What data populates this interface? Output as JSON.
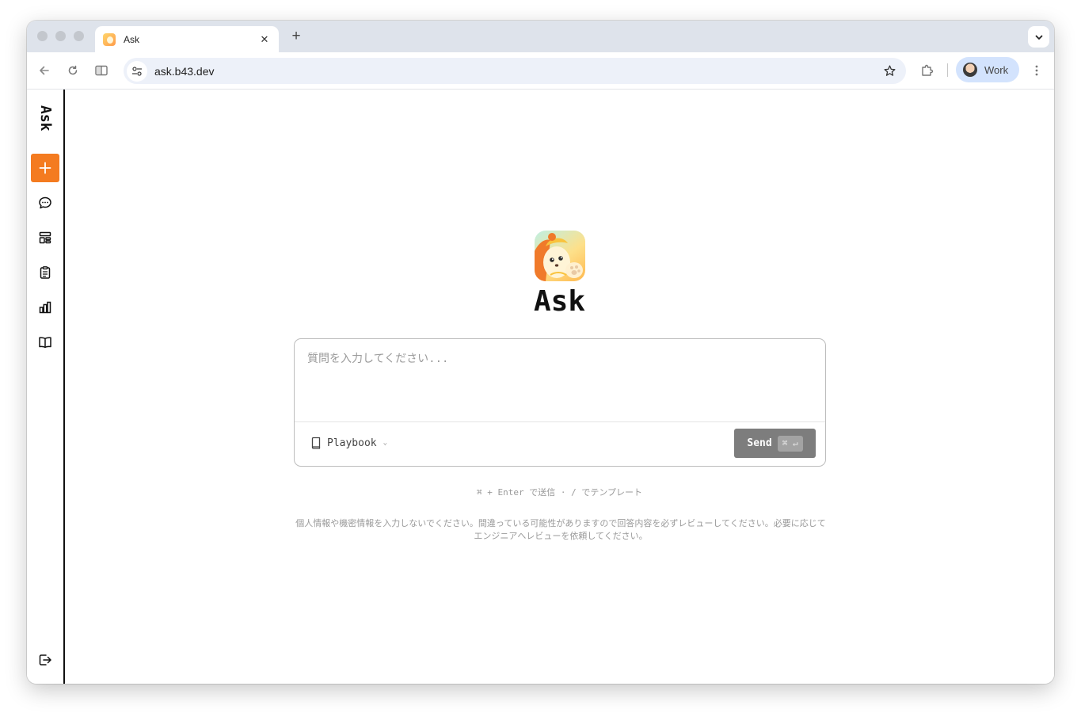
{
  "browser": {
    "tab_title": "Ask",
    "url": "ask.b43.dev",
    "profile_name": "Work"
  },
  "sidebar": {
    "brand": "Ask",
    "items": [
      {
        "name": "new-chat",
        "icon": "plus-icon"
      },
      {
        "name": "chats",
        "icon": "chat-bubble-icon"
      },
      {
        "name": "templates",
        "icon": "layout-icon"
      },
      {
        "name": "tasks",
        "icon": "clipboard-icon"
      },
      {
        "name": "analytics",
        "icon": "bar-chart-icon"
      },
      {
        "name": "docs",
        "icon": "book-icon"
      }
    ],
    "bottom_icon": "logout-icon"
  },
  "main": {
    "title": "Ask",
    "input_placeholder": "質問を入力してください...",
    "playbook_label": "Playbook",
    "send_label": "Send",
    "send_shortcut": "⌘ ↵",
    "hint": "⌘ + Enter で送信 · / でテンプレート",
    "disclaimer": "個人情報や機密情報を入力しないでください。間違っている可能性がありますので回答内容を必ずレビューしてください。必要に応じてエンジニアへレビューを依頼してください。"
  },
  "colors": {
    "accent": "#f47b20",
    "send_button": "#7d7d7d"
  }
}
